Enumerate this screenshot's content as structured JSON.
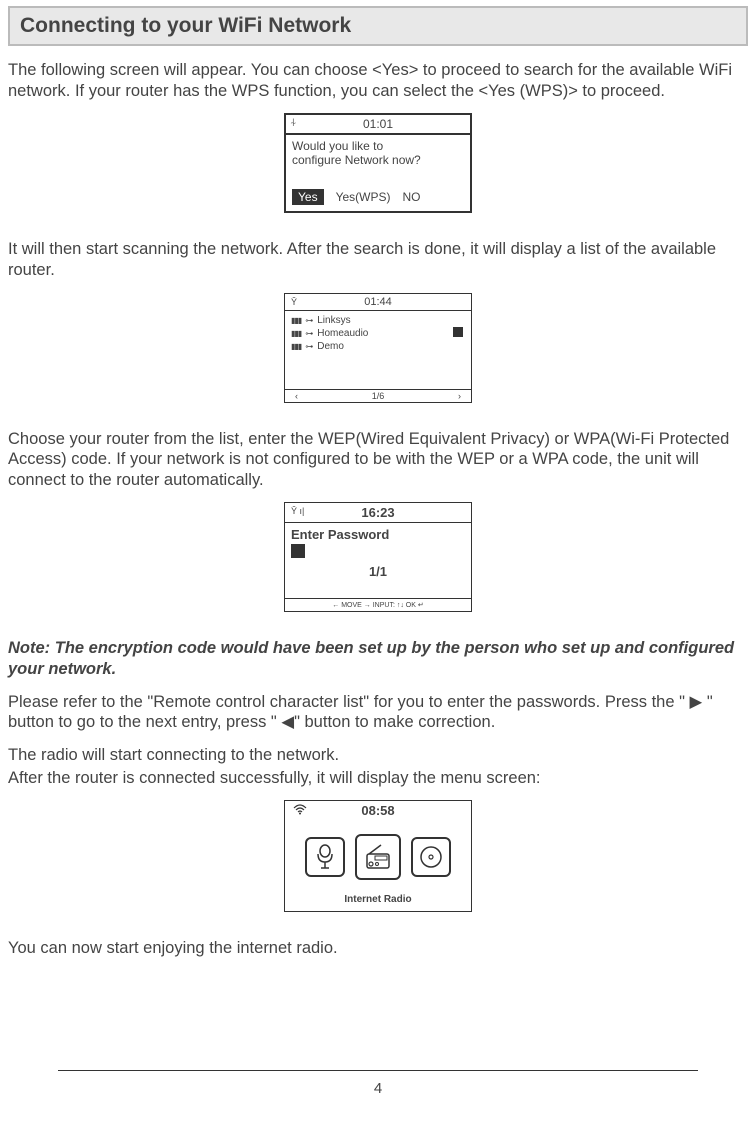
{
  "title": "Connecting to your WiFi Network",
  "p1": "The following screen will appear. You can choose <Yes> to proceed to search for the available WiFi network. If your router has the WPS function, you can select the <Yes (WPS)> to proceed.",
  "screen1": {
    "time": "01:01",
    "prompt_l1": "Would you like to",
    "prompt_l2": "configure Network now?",
    "opt_yes": "Yes",
    "opt_wps": "Yes(WPS)",
    "opt_no": "NO"
  },
  "p2": "It will then start scanning the network. After the search is done, it will display a list of the available router.",
  "screen2": {
    "time": "01:44",
    "items": [
      "Linksys",
      "Homeaudio",
      "Demo"
    ],
    "pager": "1/6"
  },
  "p3": "Choose your router from the list, enter the WEP(Wired Equivalent Privacy) or WPA(Wi-Fi Protected Access) code. If your network is not configured to be with the WEP or a WPA code, the unit will connect to the router automatically.",
  "screen3": {
    "time": "16:23",
    "title": "Enter Password",
    "pager": "1/1",
    "hint": "←  MOVE  →     INPUT: ↑↓     OK ↵"
  },
  "p4_note": "Note: The encryption code would have been set up by the person who set up and configured your network.",
  "p5": "Please refer to the \"Remote control character list\" for you to enter the passwords. Press the \" ▶ \" button to go to the next entry, press \" ◀\" button to make correction.",
  "p6": "The radio will start connecting to the network.",
  "p7": "After the router is connected successfully, it will display the menu screen:",
  "screen4": {
    "time": "08:58",
    "caption": "Internet Radio"
  },
  "p8": "You can now start enjoying the internet radio.",
  "page_no": "4"
}
